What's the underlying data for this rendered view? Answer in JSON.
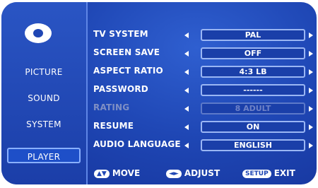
{
  "sidebar": {
    "items": [
      {
        "label": "PICTURE"
      },
      {
        "label": "SOUND"
      },
      {
        "label": "SYSTEM"
      },
      {
        "label": "PLAYER"
      }
    ],
    "active_index": 3
  },
  "settings": [
    {
      "label": "TV SYSTEM",
      "value": "PAL",
      "enabled": true
    },
    {
      "label": "SCREEN SAVE",
      "value": "OFF",
      "enabled": true
    },
    {
      "label": "ASPECT RATIO",
      "value": "4:3 LB",
      "enabled": true
    },
    {
      "label": "PASSWORD",
      "value": "------",
      "enabled": true
    },
    {
      "label": "RATING",
      "value": "8 ADULT",
      "enabled": false
    },
    {
      "label": "RESUME",
      "value": "ON",
      "enabled": true
    },
    {
      "label": "AUDIO LANGUAGE",
      "value": "ENGLISH",
      "enabled": true
    }
  ],
  "footer": {
    "move": {
      "key": "▲▼",
      "label": "MOVE"
    },
    "adjust": {
      "key": "◄►",
      "label": "ADJUST"
    },
    "exit": {
      "key": "SETUP",
      "label": "EXIT"
    }
  },
  "colors": {
    "background": "#1f47b5",
    "sidebar": "#1b3ea8",
    "text": "#ffffff",
    "disabled_text": "#7f8fc4",
    "box_border": "#9ab6f4"
  },
  "icons": {
    "logo": "circle-logo-icon",
    "left_arrow": "triangle-left-icon",
    "right_arrow": "triangle-right-icon"
  }
}
